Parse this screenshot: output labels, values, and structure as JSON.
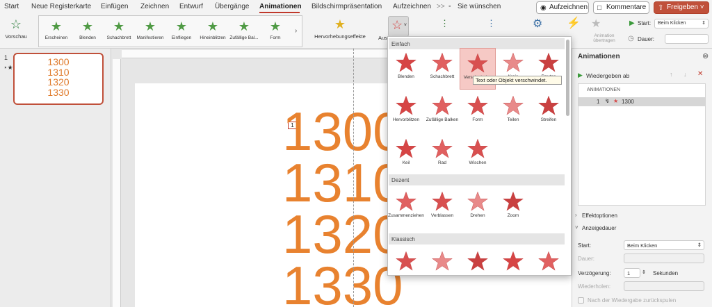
{
  "tabs": [
    "Start",
    "Neue Registerkarte",
    "Einfügen",
    "Zeichnen",
    "Entwurf",
    "Übergänge",
    "Animationen",
    "Bildschirmpräsentation",
    "Aufzeichnen",
    "Sie wünschen"
  ],
  "tabbar": {
    "more": ">>",
    "record_label": "Aufzeichnen",
    "comments_label": "Kommentare",
    "share_label": "Freigeben"
  },
  "ribbon": {
    "preview_label": "Vorschau",
    "effects": [
      "Erscheinen",
      "Blenden",
      "Schachbrett",
      "Manifestieren",
      "Einfliegen",
      "Hineinblitzen",
      "Zufällige Bal...",
      "Form"
    ],
    "emphasis_label": "Hervorhebungseffekte",
    "exit_label": "Aus",
    "anim_transfer_label": "Animation übertragen",
    "start_label": "Start:",
    "start_value": "Beim Klicken",
    "duration_label": "Dauer:"
  },
  "slide_panel": {
    "slide_number": "1",
    "thumb_lines": [
      "1300",
      "1310",
      "1320",
      "1330"
    ]
  },
  "slide": {
    "numbers": [
      "1300",
      "1310",
      "1320",
      "1330"
    ],
    "badge": "1"
  },
  "dropdown": {
    "sections": [
      "Einfach",
      "Dezent",
      "Klassisch"
    ],
    "einfach": [
      "Blenden",
      "Schachbrett",
      "Verschwinden",
      "Kreis",
      "Rauten",
      "Hervorblitzen",
      "Zufällige Balken",
      "Form",
      "Teilen",
      "Streifen",
      "Keil",
      "Rad",
      "Wischen"
    ],
    "dezent": [
      "Zusammenziehen",
      "Verblassen",
      "Drehen",
      "Zoom"
    ],
    "klassisch": [
      "",
      "",
      "",
      "",
      ""
    ]
  },
  "tooltip": "Text oder Objekt verschwindet.",
  "anim_pane": {
    "title": "Animationen",
    "play_label": "Wiedergeben ab",
    "list_header": "ANIMATIONEN",
    "item_number": "1",
    "item_label": "1300",
    "effect_options": "Effektoptionen",
    "display_duration": "Anzeigedauer",
    "start_label": "Start:",
    "start_value": "Beim Klicken",
    "duration_label": "Dauer:",
    "delay_label": "Verzögerung:",
    "delay_value": "1",
    "delay_unit": "Sekunden",
    "repeat_label": "Wiederholen:",
    "rewind_label": "Nach der Wiedergabe zurückspulen"
  }
}
